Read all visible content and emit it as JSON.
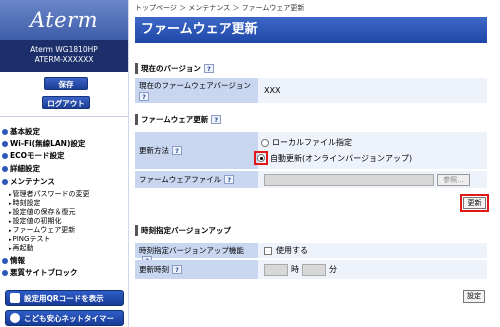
{
  "sidebar": {
    "logo": "Aterm",
    "model_line1": "Aterm WG1810HP",
    "model_line2": "ATERM-XXXXXX",
    "save_label": "保存",
    "logout_label": "ログアウト",
    "nav": [
      {
        "label": "基本設定"
      },
      {
        "label": "Wi-Fi(無線LAN)設定"
      },
      {
        "label": "ECOモード設定"
      },
      {
        "label": "詳細設定"
      },
      {
        "label": "メンテナンス"
      }
    ],
    "maintenance_items": [
      "管理者パスワードの変更",
      "時刻設定",
      "設定値の保存＆復元",
      "設定値の初期化",
      "ファームウェア更新",
      "PINGテスト",
      "再起動"
    ],
    "info_label": "情報",
    "block_label": "悪質サイトブロック",
    "qr_button": "設定用QRコードを表示",
    "kids_button": "こども安心ネットタイマー"
  },
  "main": {
    "breadcrumb": "トップページ ＞ メンテナンス ＞ ファームウェア更新",
    "title": "ファームウェア更新",
    "current_version": {
      "section_title": "現在のバージョン",
      "label": "現在のファームウェアバージョン",
      "value": "XXX"
    },
    "update": {
      "section_title": "ファームウェア更新",
      "method_label": "更新方法",
      "option_local": "ローカルファイル指定",
      "option_auto": "自動更新(オンラインバージョンアップ)",
      "selected": "auto",
      "file_label": "ファームウェアファイル",
      "browse_label": "参照...",
      "update_button": "更新"
    },
    "scheduled": {
      "section_title": "時刻指定バージョンアップ",
      "feature_label": "時刻指定バージョンアップ機能",
      "use_label": "使用する",
      "time_label": "更新時刻",
      "hour_unit": "時",
      "minute_unit": "分",
      "set_button": "設定"
    },
    "help_glyph": "?"
  }
}
